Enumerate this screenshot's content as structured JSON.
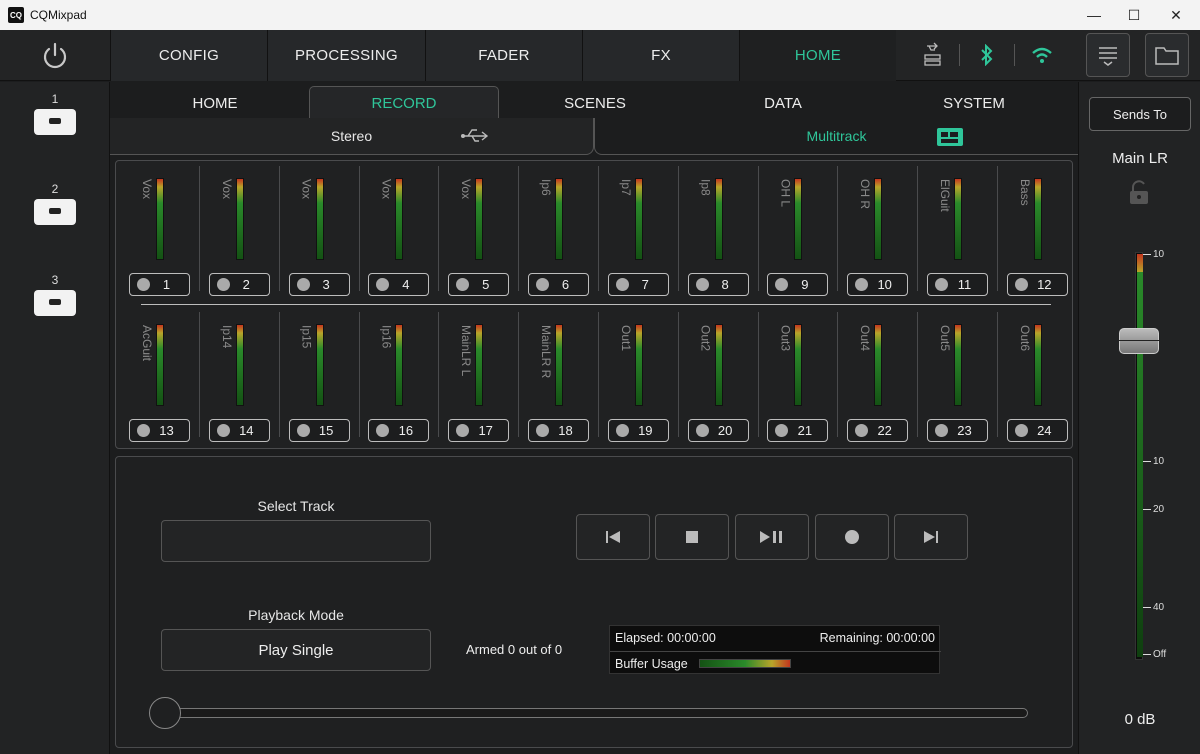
{
  "window": {
    "app_icon": "CQ",
    "title": "CQMixpad",
    "minimize": "—",
    "maximize": "☐",
    "close": "✕"
  },
  "topnav": {
    "tabs": [
      {
        "label": "CONFIG"
      },
      {
        "label": "PROCESSING"
      },
      {
        "label": "FADER"
      },
      {
        "label": "FX"
      },
      {
        "label": "HOME"
      }
    ],
    "active": "HOME"
  },
  "sidebar": {
    "slots": [
      {
        "number": "1"
      },
      {
        "number": "2"
      },
      {
        "number": "3"
      }
    ]
  },
  "subtabs": {
    "items": [
      {
        "label": "HOME"
      },
      {
        "label": "RECORD"
      },
      {
        "label": "SCENES"
      },
      {
        "label": "DATA"
      },
      {
        "label": "SYSTEM"
      }
    ],
    "active": "RECORD"
  },
  "modes": {
    "stereo": "Stereo",
    "multitrack": "Multitrack"
  },
  "channels": [
    {
      "label": "Vox",
      "num": "1"
    },
    {
      "label": "Vox",
      "num": "2"
    },
    {
      "label": "Vox",
      "num": "3"
    },
    {
      "label": "Vox",
      "num": "4"
    },
    {
      "label": "Vox",
      "num": "5"
    },
    {
      "label": "Ip6",
      "num": "6"
    },
    {
      "label": "Ip7",
      "num": "7"
    },
    {
      "label": "Ip8",
      "num": "8"
    },
    {
      "label": "OH L",
      "num": "9"
    },
    {
      "label": "OH R",
      "num": "10"
    },
    {
      "label": "ElGuit",
      "num": "11"
    },
    {
      "label": "Bass",
      "num": "12"
    },
    {
      "label": "AcGuit",
      "num": "13"
    },
    {
      "label": "Ip14",
      "num": "14"
    },
    {
      "label": "Ip15",
      "num": "15"
    },
    {
      "label": "Ip16",
      "num": "16"
    },
    {
      "label": "MainLR L",
      "num": "17"
    },
    {
      "label": "MainLR R",
      "num": "18"
    },
    {
      "label": "Out1",
      "num": "19"
    },
    {
      "label": "Out2",
      "num": "20"
    },
    {
      "label": "Out3",
      "num": "21"
    },
    {
      "label": "Out4",
      "num": "22"
    },
    {
      "label": "Out5",
      "num": "23"
    },
    {
      "label": "Out6",
      "num": "24"
    }
  ],
  "transport": {
    "select_track_label": "Select Track",
    "select_track_value": "",
    "playback_mode_label": "Playback Mode",
    "playback_mode_value": "Play Single",
    "armed": "Armed 0 out of 0",
    "elapsed": "Elapsed: 00:00:00",
    "remaining": "Remaining: 00:00:00",
    "buffer_usage": "Buffer Usage",
    "buttons": [
      "skip-back-icon",
      "stop-icon",
      "play-pause-icon",
      "record-icon",
      "skip-forward-icon"
    ]
  },
  "right": {
    "sends_to": "Sends To",
    "main_lr": "Main LR",
    "scale": [
      "10",
      "0",
      "10",
      "20",
      "40",
      "Off"
    ],
    "db_value": "0 dB"
  },
  "colors": {
    "accent": "#2fc69a",
    "bg": "#1c1d1e",
    "panel": "#202122"
  }
}
